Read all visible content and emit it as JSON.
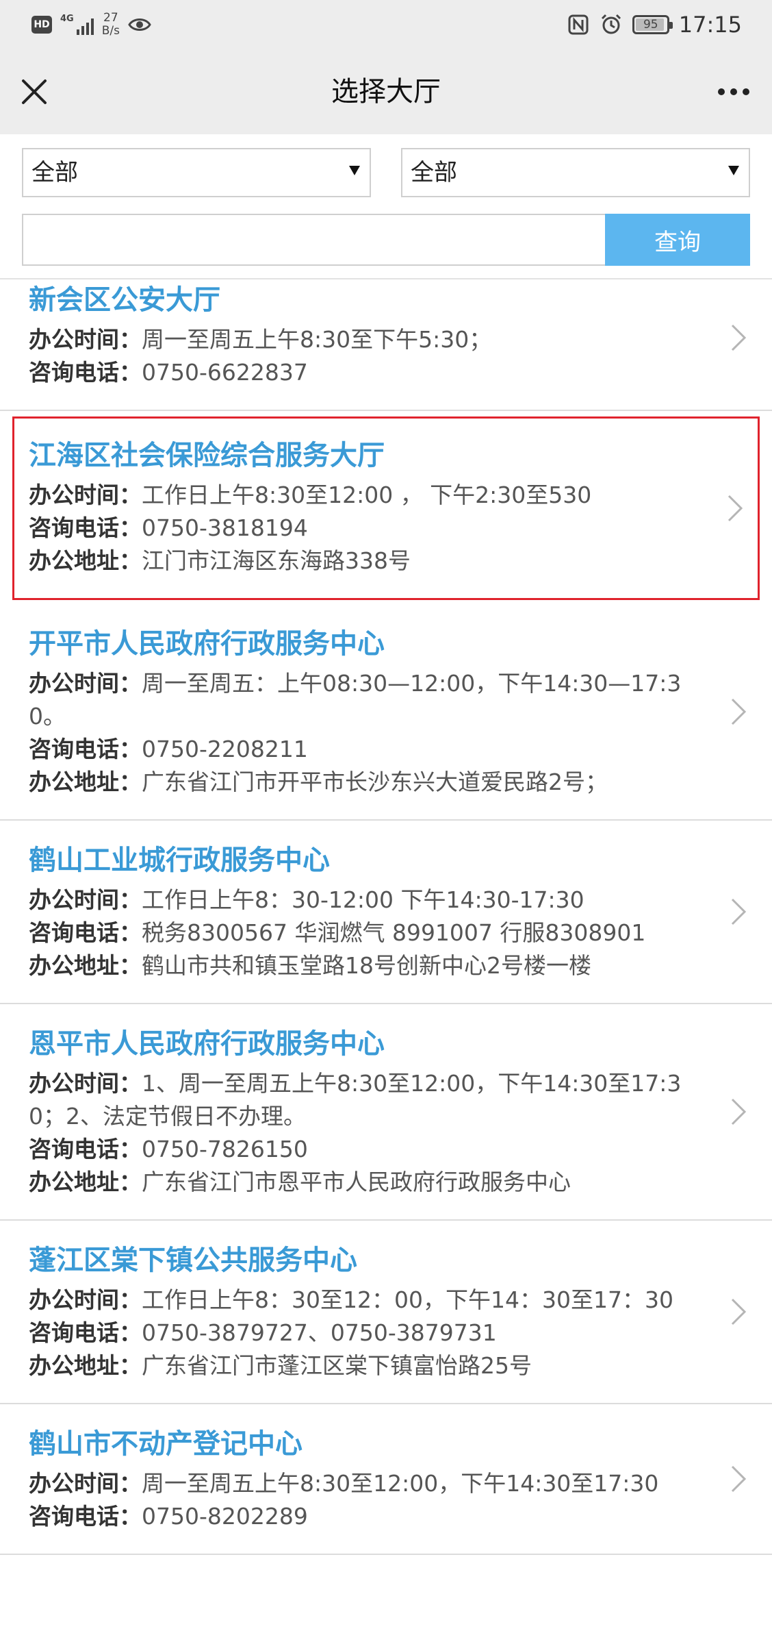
{
  "status_bar": {
    "hd": "HD",
    "network": "4G",
    "speed_value": "27",
    "speed_unit": "B/s",
    "battery": "95",
    "battery_level": 0.95,
    "time": "17:15"
  },
  "nav": {
    "title": "选择大厅"
  },
  "filters": {
    "select_1": "全部",
    "select_2": "全部",
    "search_placeholder": "",
    "search_button": "查询"
  },
  "labels": {
    "hours": "办公时间：",
    "phone": "咨询电话：",
    "address": "办公地址："
  },
  "halls": [
    {
      "name": "新会区公安大厅",
      "hours": "周一至周五上午8:30至下午5:30；",
      "phone": "0750-6622837"
    },
    {
      "name": "江海区社会保险综合服务大厅",
      "hours": "工作日上午8:30至12:00 ， 下午2:30至530",
      "phone": "0750-3818194",
      "address": "江门市江海区东海路338号"
    },
    {
      "name": "开平市人民政府行政服务中心",
      "hours": "周一至周五：上午08:30—12:00，下午14:30—17:30。",
      "phone": "0750-2208211",
      "address": "广东省江门市开平市长沙东兴大道爱民路2号；"
    },
    {
      "name": "鹤山工业城行政服务中心",
      "hours": "工作日上午8：30-12:00 下午14:30-17:30",
      "phone": "税务8300567 华润燃气 8991007 行服8308901",
      "address": "鹤山市共和镇玉堂路18号创新中心2号楼一楼"
    },
    {
      "name": "恩平市人民政府行政服务中心",
      "hours": "1、周一至周五上午8:30至12:00，下午14:30至17:30；2、法定节假日不办理。",
      "phone": "0750-7826150",
      "address": "广东省江门市恩平市人民政府行政服务中心"
    },
    {
      "name": "蓬江区棠下镇公共服务中心",
      "hours": "工作日上午8：30至12：00，下午14：30至17：30",
      "phone": "0750-3879727、0750-3879731",
      "address": "广东省江门市蓬江区棠下镇富怡路25号"
    },
    {
      "name": "鹤山市不动产登记中心",
      "hours": "周一至周五上午8:30至12:00，下午14:30至17:30",
      "phone": "0750-8202289"
    }
  ]
}
